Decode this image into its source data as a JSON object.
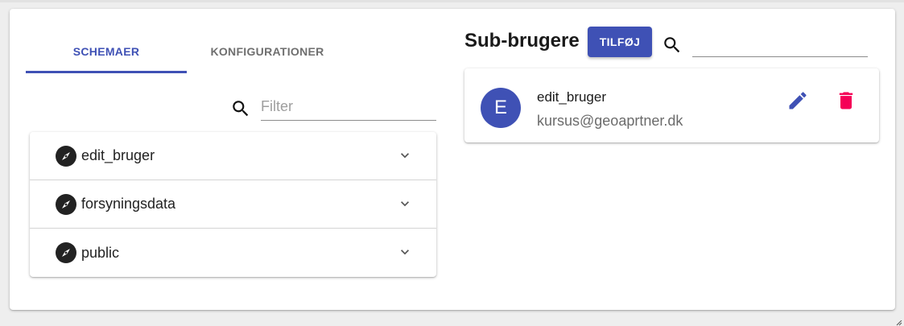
{
  "tabs": [
    {
      "label": "SCHEMAER",
      "active": true
    },
    {
      "label": "KONFIGURATIONER",
      "active": false
    }
  ],
  "filter": {
    "placeholder": "Filter",
    "value": ""
  },
  "schemas": [
    {
      "label": "edit_bruger",
      "icon": "compass-icon"
    },
    {
      "label": "forsyningsdata",
      "icon": "compass-icon"
    },
    {
      "label": "public",
      "icon": "compass-icon"
    }
  ],
  "sub_users": {
    "title": "Sub-brugere",
    "add_label": "TILFØJ",
    "search_value": "",
    "users": [
      {
        "initial": "E",
        "name": "edit_bruger",
        "email": "kursus@geoaprtner.dk"
      }
    ]
  },
  "colors": {
    "primary": "#3f51b5",
    "delete": "#f50057",
    "icon_dark": "#222222"
  }
}
